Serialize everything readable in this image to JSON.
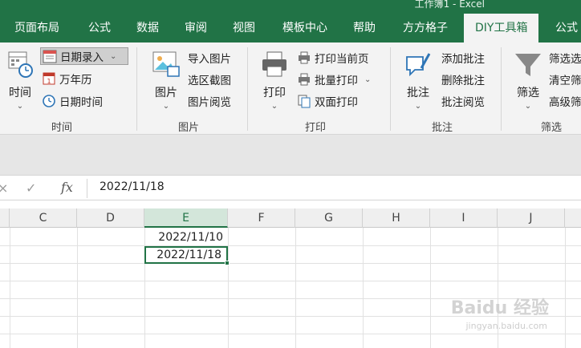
{
  "window": {
    "title": "工作簿1 - Excel"
  },
  "tabs": [
    {
      "label": "页面布局"
    },
    {
      "label": "公式"
    },
    {
      "label": "数据"
    },
    {
      "label": "审阅"
    },
    {
      "label": "视图"
    },
    {
      "label": "模板中心"
    },
    {
      "label": "帮助"
    },
    {
      "label": "方方格子"
    },
    {
      "label": "DIY工具箱",
      "active": true
    },
    {
      "label": "公式"
    }
  ],
  "ribbon": {
    "time_group": {
      "label": "时间",
      "time_button": "时间",
      "date_entry": "日期录入",
      "calendar": "万年历",
      "date_time": "日期时间"
    },
    "picture_group": {
      "label": "图片",
      "picture_button": "图片",
      "import_picture": "导入图片",
      "region_screenshot": "选区截图",
      "picture_browse": "图片阅览"
    },
    "print_group": {
      "label": "打印",
      "print_button": "打印",
      "print_current_page": "打印当前页",
      "batch_print": "批量打印",
      "duplex_print": "双面打印"
    },
    "comment_group": {
      "label": "批注",
      "comment_button": "批注",
      "add_comment": "添加批注",
      "delete_comment": "删除批注",
      "comment_browse": "批注阅览"
    },
    "filter_group": {
      "label": "筛选",
      "filter_button": "筛选",
      "filter_select": "筛选选",
      "clear_filter": "清空筛",
      "advanced_filter": "高级筛"
    }
  },
  "formula_bar": {
    "cancel_symbol": "×",
    "confirm_symbol": "✓",
    "fx_label": "fx",
    "value": "2022/11/18"
  },
  "sheet": {
    "columns": [
      "C",
      "D",
      "E",
      "F",
      "G",
      "H",
      "I",
      "J"
    ],
    "selected_column": "E",
    "cells": {
      "E_row1": "2022/11/10",
      "E_row2": "2022/11/18"
    }
  },
  "watermark": {
    "main": "Baidu 经验",
    "sub": "jingyan.baidu.com"
  },
  "colors": {
    "accent": "#217346",
    "ribbon_bg": "#f3f3f3",
    "selected_header_bg": "#d3e6da"
  }
}
